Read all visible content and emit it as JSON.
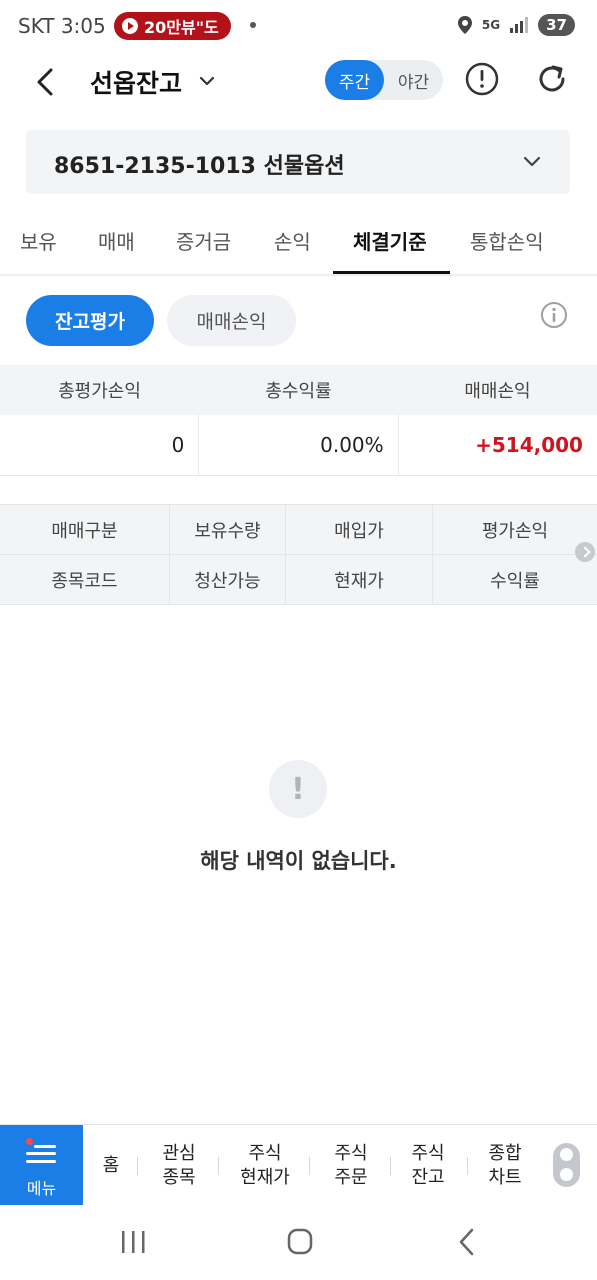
{
  "status_bar": {
    "carrier_time": "SKT 3:05",
    "notification": "20만뷰\"도",
    "network": "5G",
    "battery": "37"
  },
  "header": {
    "title": "선옵잔고",
    "session_toggle": {
      "day": "주간",
      "night": "야간",
      "selected": "주간"
    }
  },
  "account": {
    "label": "8651-2135-1013 선물옵션"
  },
  "tabs": [
    {
      "label": "보유"
    },
    {
      "label": "매매"
    },
    {
      "label": "증거금"
    },
    {
      "label": "손익"
    },
    {
      "label": "체결기준",
      "active": true
    },
    {
      "label": "통합손익"
    }
  ],
  "sub_toggle": {
    "balance_eval": "잔고평가",
    "trade_pl": "매매손익",
    "selected": "잔고평가"
  },
  "summary": {
    "headers": [
      "총평가손익",
      "총수익률",
      "매매손익"
    ],
    "values": [
      "0",
      "0.00%",
      "+514,000"
    ]
  },
  "holdings_columns": {
    "row1": [
      "매매구분",
      "보유수량",
      "매입가",
      "평가손익"
    ],
    "row2": [
      "종목코드",
      "청산가능",
      "현재가",
      "수익률"
    ]
  },
  "empty_state": {
    "icon": "!",
    "message": "해당 내역이 없습니다."
  },
  "bottom_nav": {
    "menu": "메뉴",
    "home": "홈",
    "items": [
      {
        "line1": "관심",
        "line2": "종목"
      },
      {
        "line1": "주식",
        "line2": "현재가"
      },
      {
        "line1": "주식",
        "line2": "주문"
      },
      {
        "line1": "주식",
        "line2": "잔고"
      },
      {
        "line1": "종합",
        "line2": "차트"
      }
    ]
  },
  "colors": {
    "accent": "#1a7ee6",
    "profit_red": "#d0151f",
    "header_bg": "#f2f4f6"
  }
}
